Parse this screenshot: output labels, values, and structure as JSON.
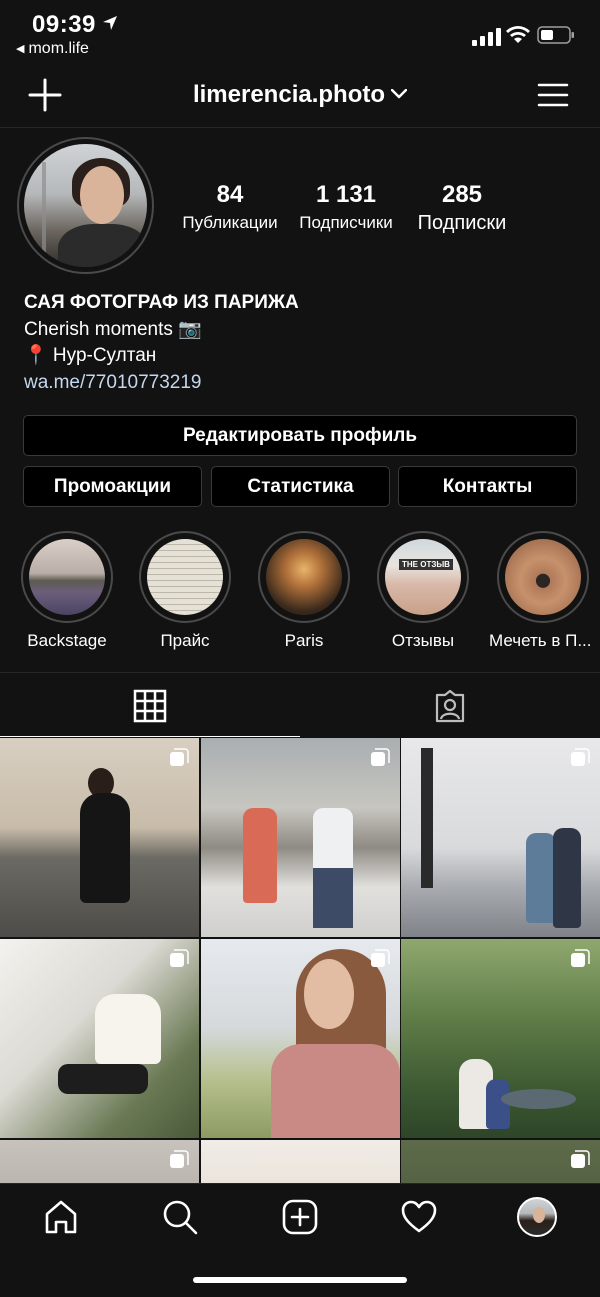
{
  "status_bar": {
    "time": "09:39",
    "back_app": "mom.life"
  },
  "header": {
    "username": "limerencia.photo"
  },
  "profile": {
    "stats": [
      {
        "number": "84",
        "label": "Публикации"
      },
      {
        "number": "1 131",
        "label": "Подписчики"
      },
      {
        "number": "285",
        "label": "Подписки"
      }
    ],
    "bio": {
      "name": "САЯ ФОТОГРАФ ИЗ ПАРИЖА",
      "line1": "Cherish moments 📷",
      "line2": "📍 Нур-Султан",
      "link": "wa.me/77010773219"
    }
  },
  "buttons": {
    "edit_profile": "Редактировать профиль",
    "promotions": "Промоакции",
    "statistics": "Статистика",
    "contacts": "Контакты"
  },
  "highlights": [
    {
      "label": "Backstage"
    },
    {
      "label": "Прайс"
    },
    {
      "label": "Paris"
    },
    {
      "label": "Отзывы"
    },
    {
      "label": "Мечеть в П..."
    }
  ],
  "highlight_review_text": "THE ОТЗЫВ",
  "icons": {
    "header_left": "plus-icon",
    "header_menu": "menu-icon",
    "tab_grid": "grid-icon",
    "tab_tagged": "tagged-icon",
    "nav": [
      "home-icon",
      "search-icon",
      "add-post-icon",
      "heart-icon",
      "profile-avatar"
    ]
  },
  "colors": {
    "background": "#121212",
    "link": "#c5d7ee",
    "border": "#3a3a3a"
  }
}
